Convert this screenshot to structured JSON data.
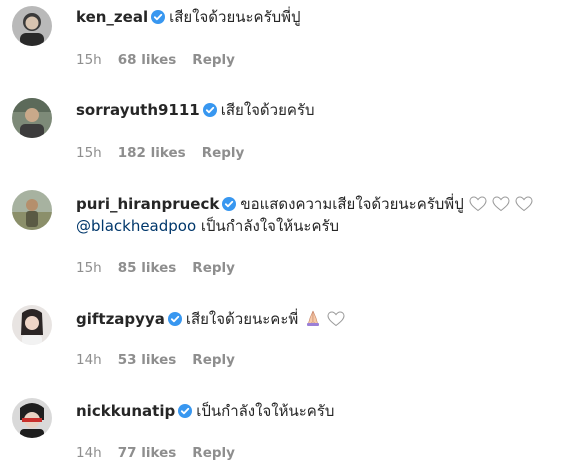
{
  "comments": [
    {
      "username": "ken_zeal",
      "text": "เสียใจด้วยนะครับพี่ปู",
      "time": "15h",
      "likes": "68 likes",
      "reply": "Reply"
    },
    {
      "username": "sorrayuth9111",
      "text": "เสียใจด้วยครับ",
      "time": "15h",
      "likes": "182 likes",
      "reply": "Reply"
    },
    {
      "username": "puri_hiranprueck",
      "text": "ขอแสดงความเสียใจด้วยนะครับพี่ปู",
      "mention": "@blackheadpoo",
      "text2": " เป็นกำลังใจให้นะครับ",
      "time": "15h",
      "likes": "85 likes",
      "reply": "Reply"
    },
    {
      "username": "giftzapyya",
      "text": "เสียใจด้วยนะคะพี่",
      "time": "14h",
      "likes": "53 likes",
      "reply": "Reply"
    },
    {
      "username": "nickkunatip",
      "text": "เป็นกำลังใจให้นะครับ",
      "time": "14h",
      "likes": "77 likes",
      "reply": "Reply"
    }
  ],
  "icons": {
    "verified": "verified-badge-icon",
    "heart": "white-heart-emoji",
    "praying": "praying-hands-emoji"
  },
  "colors": {
    "verified": "#3897f0",
    "text": "#262626",
    "meta": "#8e8e8e",
    "mention": "#00376b"
  }
}
